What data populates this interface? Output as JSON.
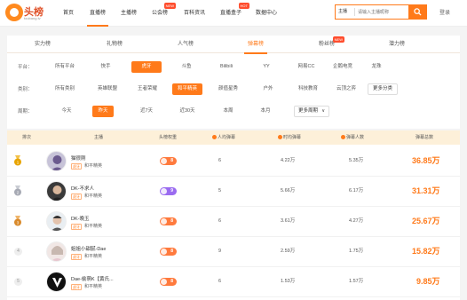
{
  "header": {
    "logo_text": "头榜",
    "logo_sub": "toubang.tv",
    "nav": [
      {
        "label": "首页",
        "active": false,
        "badge": ""
      },
      {
        "label": "直播榜",
        "active": true,
        "badge": ""
      },
      {
        "label": "主播榜",
        "active": false,
        "badge": ""
      },
      {
        "label": "公会榜",
        "active": false,
        "badge": "NEW"
      },
      {
        "label": "百科资讯",
        "active": false,
        "badge": ""
      },
      {
        "label": "直播盒子",
        "active": false,
        "badge": "HOT"
      },
      {
        "label": "数据中心",
        "active": false,
        "badge": ""
      }
    ],
    "search": {
      "type": "主播",
      "placeholder": "请输入主播昵称"
    },
    "login": "登录"
  },
  "tabs": [
    {
      "label": "实力榜",
      "active": false,
      "badge": ""
    },
    {
      "label": "礼物榜",
      "active": false,
      "badge": ""
    },
    {
      "label": "人气榜",
      "active": false,
      "badge": ""
    },
    {
      "label": "弹幕榜",
      "active": true,
      "badge": ""
    },
    {
      "label": "粉丝榜",
      "active": false,
      "badge": "NEW"
    },
    {
      "label": "潜力榜",
      "active": false,
      "badge": ""
    }
  ],
  "filters": {
    "platform": {
      "label": "平台：",
      "options": [
        "所有平台",
        "快手",
        "虎牙",
        "斗鱼",
        "Bilibili",
        "YY",
        "网易CC",
        "企鹅电竞",
        "龙珠"
      ],
      "selected": 2
    },
    "category": {
      "label": "类别：",
      "options": [
        "所有类别",
        "英雄联盟",
        "王者荣耀",
        "和平精英",
        "颜值星秀",
        "户外",
        "科技教育",
        "云顶之弈"
      ],
      "selected": 3,
      "more": "更多分类"
    },
    "period": {
      "label": "周期：",
      "options": [
        "今天",
        "昨天",
        "近7天",
        "近30天",
        "本周",
        "本月"
      ],
      "selected": 1,
      "more": "更多周期"
    }
  },
  "table": {
    "headers": [
      "排次",
      "主播",
      "头榜权重",
      "人均弹幕",
      "时均弹幕",
      "弹幕人数",
      "弹幕总数"
    ],
    "rows": [
      {
        "rank": "1",
        "name": "猫很刚",
        "platform": "虎牙",
        "game": "和平精英",
        "weight": "8",
        "weight_color": "#ff7a3d",
        "per_person": "6",
        "per_hour": "4.22万",
        "people": "5.35万",
        "total": "36.85万"
      },
      {
        "rank": "2",
        "name": "DK-不求人",
        "platform": "虎牙",
        "game": "和平精英",
        "weight": "9",
        "weight_color": "#9a6bf0",
        "per_person": "5",
        "per_hour": "5.66万",
        "people": "6.17万",
        "total": "31.31万"
      },
      {
        "rank": "3",
        "name": "DK-晚玉",
        "platform": "虎牙",
        "game": "和平精英",
        "weight": "8",
        "weight_color": "#ff7a3d",
        "per_person": "6",
        "per_hour": "3.61万",
        "people": "4.27万",
        "total": "25.67万"
      },
      {
        "rank": "4",
        "name": "姐姐小甜腻-Dae",
        "platform": "虎牙",
        "game": "和平精英",
        "weight": "8",
        "weight_color": "#ff7a3d",
        "per_person": "9",
        "per_hour": "2.59万",
        "people": "1.75万",
        "total": "15.82万"
      },
      {
        "rank": "5",
        "name": "Dae-偷萌K【黄氏...",
        "platform": "虎牙",
        "game": "和平精英",
        "weight": "8",
        "weight_color": "#ff7a3d",
        "per_person": "6",
        "per_hour": "1.53万",
        "people": "1.57万",
        "total": "9.85万"
      }
    ]
  },
  "colors": {
    "accent": "#ff7a1a",
    "gold": "#e8a400",
    "silver": "#a7aab4",
    "bronze": "#d98a2b"
  }
}
